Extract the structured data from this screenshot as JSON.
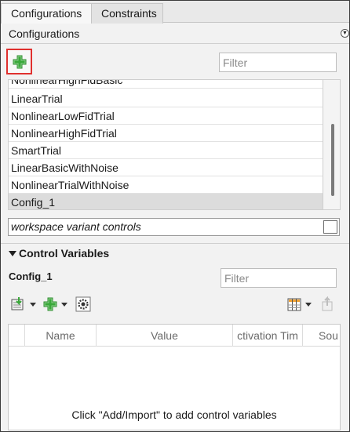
{
  "tabs": [
    {
      "label": "Configurations",
      "active": true
    },
    {
      "label": "Constraints",
      "active": false
    }
  ],
  "configurations_panel": {
    "title": "Configurations",
    "filter_placeholder": "Filter",
    "items": [
      {
        "label": "NonlinearHighFidBasic",
        "selected": false
      },
      {
        "label": "LinearTrial",
        "selected": false
      },
      {
        "label": "NonlinearLowFidTrial",
        "selected": false
      },
      {
        "label": "NonlinearHighFidTrial",
        "selected": false
      },
      {
        "label": "SmartTrial",
        "selected": false
      },
      {
        "label": "LinearBasicWithNoise",
        "selected": false
      },
      {
        "label": "NonlinearTrialWithNoise",
        "selected": false
      },
      {
        "label": "Config_1",
        "selected": true
      }
    ],
    "workspace_label": "workspace variant controls"
  },
  "control_variables": {
    "title": "Control Variables",
    "config_name": "Config_1",
    "filter_placeholder": "Filter",
    "columns": [
      "Name",
      "Value",
      "ctivation Tim",
      "Sou"
    ],
    "empty_message": "Click \"Add/Import\" to add control variables"
  },
  "icons": {
    "add": "plus-icon",
    "import": "import-icon",
    "settings": "gear-icon",
    "columns": "column-layout-icon",
    "export": "export-icon"
  },
  "colors": {
    "highlight_border": "#e0302e",
    "plus_green": "#3aa83a",
    "selected_row": "#dcdcdc"
  }
}
